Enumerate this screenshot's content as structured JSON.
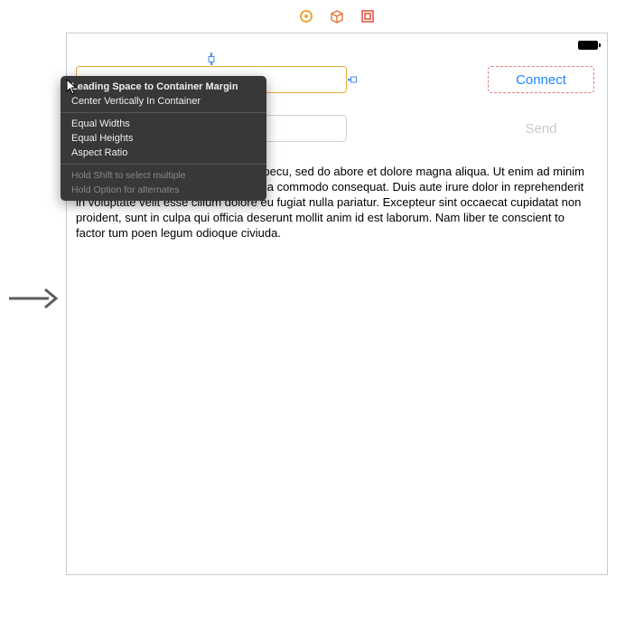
{
  "toolbar": {
    "icons": [
      "disk-icon",
      "box-icon",
      "embed-icon"
    ]
  },
  "canvas": {
    "connect_label": "Connect",
    "send_label": "Send",
    "body_text": "net, consectetaur cillium adipisicing pecu, sed do abore et dolore magna aliqua. Ut enim ad minim on ullamco laboris nisi ut aliquip ex ea commodo consequat. Duis aute irure dolor in reprehenderit in voluptate velit esse cillum dolore eu fugiat nulla pariatur. Excepteur sint occaecat cupidatat non proident, sunt in culpa qui officia deserunt mollit anim id est laborum. Nam liber te conscient to factor tum poen legum odioque civiuda."
  },
  "menu": {
    "section1": [
      "Leading Space to Container Margin",
      "Center Vertically In Container"
    ],
    "section2": [
      "Equal Widths",
      "Equal Heights",
      "Aspect Ratio"
    ],
    "hints": [
      "Hold Shift to select multiple",
      "Hold Option for alternates"
    ]
  }
}
